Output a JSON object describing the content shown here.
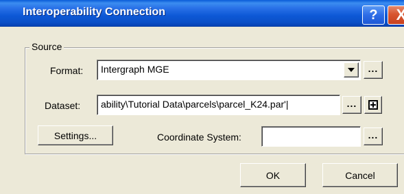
{
  "window": {
    "title": "Interoperability Connection",
    "help_glyph": "?",
    "close_glyph": "X"
  },
  "source": {
    "group_label": "Source",
    "format_label": "Format:",
    "format_value": "Intergraph MGE",
    "dataset_label": "Dataset:",
    "dataset_value": "ability\\Tutorial Data\\parcels\\parcel_K24.par'|",
    "settings_button": "Settings...",
    "coordinate_system_label": "Coordinate System:",
    "coordinate_system_value": "",
    "browse_glyph": "..."
  },
  "buttons": {
    "ok": "OK",
    "cancel": "Cancel"
  }
}
